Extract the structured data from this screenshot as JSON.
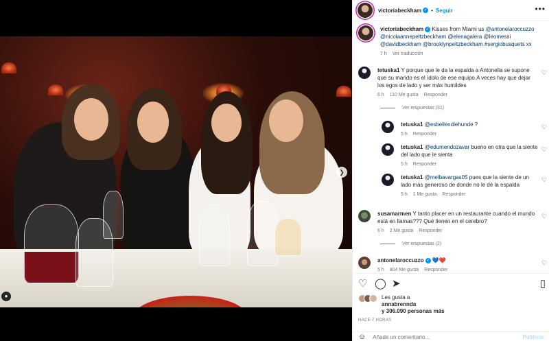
{
  "header": {
    "username": "victoriabeckham",
    "follow_label": "Seguir",
    "dot": "•",
    "more_icon": "more-horizontal-icon"
  },
  "caption": {
    "username": "victoriabeckham",
    "text": "Kisses from Miami us",
    "tags": "@antonelaroccuzzo @nicolaannepeltzbeckham @elenagalera @leomessi @davidbeckham @brooklynpeltzbeckham #sergiobusquets xx",
    "time": "7 h",
    "translate": "Ver traducción"
  },
  "comments": [
    {
      "username": "tetuska1",
      "text": "Y porque que le da la espalda a Antonella se supone que su marido es el ídolo de ese equipo.A veces hay que dejar los egos de lado y ser más humildes",
      "time": "6 h",
      "likes": "110 Me gusta",
      "reply": "Responder",
      "view_replies": "Ver respuestas (31)"
    },
    {
      "username": "tetuska1",
      "mention": "@esbellendiehunde",
      "text": "?",
      "time": "5 h",
      "reply": "Responder"
    },
    {
      "username": "tetuska1",
      "mention": "@edumendozavar",
      "text": "bueno en otra que la siente del lado que le sienta",
      "time": "5 h",
      "reply": "Responder"
    },
    {
      "username": "tetuska1",
      "mention": "@melbavargas05",
      "text": "pues que la siente de un lado más generoso de donde no le dé la espalda",
      "time": "5 h",
      "likes": "1 Me gusta",
      "reply": "Responder"
    },
    {
      "username": "susamarmen",
      "text": "Y tanto placer en un restaurante cuando el mundo está en llamas??? Qué tienen en el cerebro?",
      "time": "6 h",
      "likes": "2 Me gusta",
      "reply": "Responder",
      "view_replies": "Ver respuestas (2)"
    },
    {
      "username": "antonelaroccuzzo",
      "text": "💙❤️",
      "time": "5 h",
      "likes": "804 Me gusta",
      "reply": "Responder"
    }
  ],
  "actions": {
    "likes_prefix": "Les gusta a",
    "liker": "annabrennda",
    "others": "y 306.090 personas más",
    "time_ago": "HACE 7 HORAS"
  },
  "composer": {
    "placeholder": "Añade un comentario...",
    "publish": "Publicar"
  },
  "colors": {
    "accent": "#0095f6",
    "link": "#00376b",
    "muted": "#737373"
  }
}
